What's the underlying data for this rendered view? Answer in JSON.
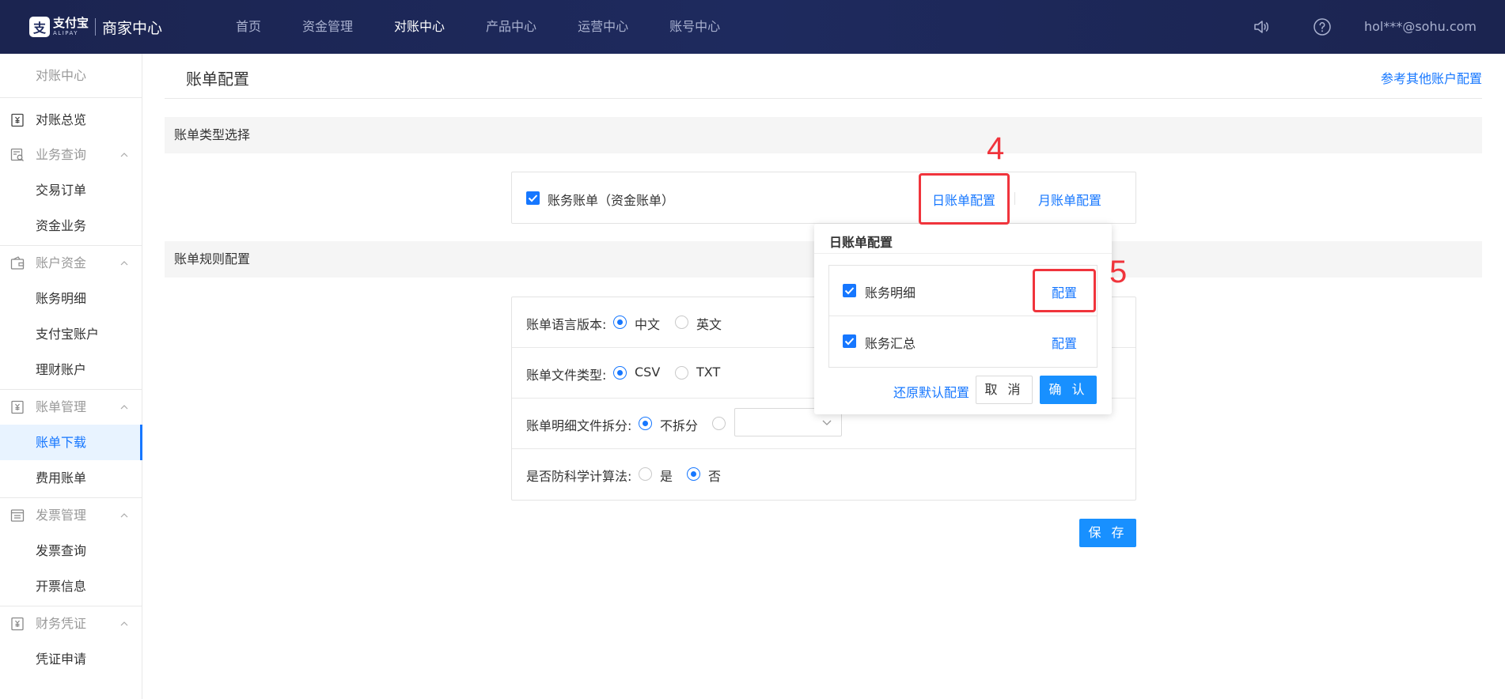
{
  "header": {
    "logo_glyph": "支",
    "logo_cn": "支付宝",
    "logo_en": "ALIPAY",
    "logo_sub": "商家中心",
    "nav": [
      {
        "label": "首页",
        "active": false
      },
      {
        "label": "资金管理",
        "active": false
      },
      {
        "label": "对账中心",
        "active": true
      },
      {
        "label": "产品中心",
        "active": false
      },
      {
        "label": "运营中心",
        "active": false
      },
      {
        "label": "账号中心",
        "active": false
      }
    ],
    "user": "hol***@sohu.com"
  },
  "sidebar": {
    "head": "对账中心",
    "overview": "对账总览",
    "groups": [
      {
        "title": "业务查询",
        "items": [
          "交易订单",
          "资金业务"
        ]
      },
      {
        "title": "账户资金",
        "items": [
          "账务明细",
          "支付宝账户",
          "理财账户"
        ]
      },
      {
        "title": "账单管理",
        "items": [
          "账单下载",
          "费用账单"
        ]
      },
      {
        "title": "发票管理",
        "items": [
          "发票查询",
          "开票信息"
        ]
      },
      {
        "title": "财务凭证",
        "items": [
          "凭证申请"
        ]
      }
    ],
    "active_item": "账单下载"
  },
  "main": {
    "title": "账单配置",
    "ref_link": "参考其他账户配置",
    "section1": "账单类型选择",
    "section2": "账单规则配置",
    "bill_type": {
      "label": "账务账单（资金账单）",
      "checked": true,
      "daily_link": "日账单配置",
      "monthly_link": "月账单配置"
    },
    "rules": {
      "language": {
        "label": "账单语言版本:",
        "options": [
          "中文",
          "英文"
        ],
        "selected": "中文"
      },
      "filetype": {
        "label": "账单文件类型:",
        "options": [
          "CSV",
          "TXT"
        ],
        "selected": "CSV"
      },
      "split": {
        "label": "账单明细文件拆分:",
        "option": "不拆分",
        "selected": "不拆分"
      },
      "scientific": {
        "label": "是否防科学计算法:",
        "options": [
          "是",
          "否"
        ],
        "selected": "否"
      }
    },
    "save": "保 存"
  },
  "popover": {
    "title": "日账单配置",
    "rows": [
      {
        "label": "账务明细",
        "checked": true,
        "action": "配置"
      },
      {
        "label": "账务汇总",
        "checked": true,
        "action": "配置"
      }
    ],
    "reset": "还原默认配置",
    "cancel": "取 消",
    "ok": "确 认"
  },
  "annotations": {
    "step4": "4",
    "step5": "5",
    "color": "#f0343c"
  },
  "colors": {
    "accent": "#1677ff",
    "header_bg": "#1e2a5e"
  }
}
